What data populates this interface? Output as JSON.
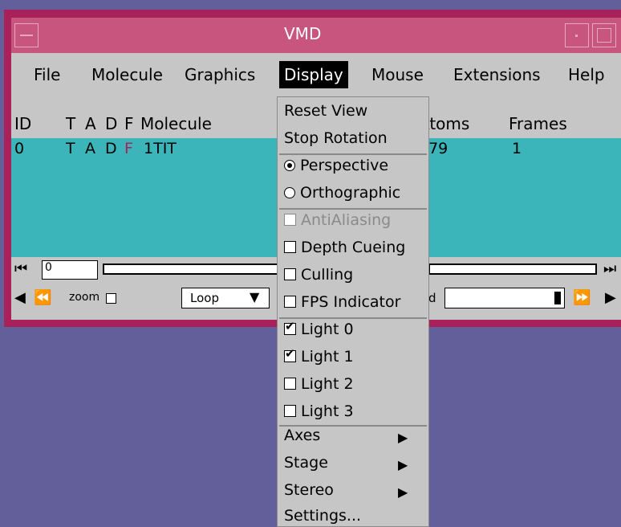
{
  "window": {
    "title": "VMD"
  },
  "menubar": {
    "items": [
      "File",
      "Molecule",
      "Graphics",
      "Display",
      "Mouse",
      "Extensions",
      "Help"
    ],
    "active": "Display"
  },
  "table": {
    "headers": [
      "ID",
      "T",
      "A",
      "D",
      "F",
      "Molecule",
      "Atoms",
      "Frames"
    ],
    "rows": [
      {
        "id": "0",
        "t": "T",
        "a": "A",
        "d": "D",
        "f": "F",
        "molecule": "1TIT",
        "atoms": "379",
        "frames": "1"
      }
    ]
  },
  "controls": {
    "frame_value": "0",
    "zoom_label": "zoom",
    "loop_value": "Loop",
    "speed_label": "d"
  },
  "display_menu": {
    "items": [
      {
        "label": "Reset View",
        "type": "command"
      },
      {
        "label": "Stop Rotation",
        "type": "command"
      },
      {
        "label": "Perspective",
        "type": "radio",
        "selected": true
      },
      {
        "label": "Orthographic",
        "type": "radio",
        "selected": false
      },
      {
        "label": "AntiAliasing",
        "type": "check",
        "checked": false,
        "disabled": true
      },
      {
        "label": "Depth Cueing",
        "type": "check",
        "checked": false
      },
      {
        "label": "Culling",
        "type": "check",
        "checked": false
      },
      {
        "label": "FPS Indicator",
        "type": "check",
        "checked": false
      },
      {
        "label": "Light 0",
        "type": "check",
        "checked": true
      },
      {
        "label": "Light 1",
        "type": "check",
        "checked": true
      },
      {
        "label": "Light 2",
        "type": "check",
        "checked": false
      },
      {
        "label": "Light 3",
        "type": "check",
        "checked": false
      },
      {
        "label": "Axes",
        "type": "submenu"
      },
      {
        "label": "Stage",
        "type": "submenu"
      },
      {
        "label": "Stereo",
        "type": "submenu"
      },
      {
        "label": "Settings...",
        "type": "command"
      }
    ]
  },
  "colors": {
    "desktop": "#625f9b",
    "window_frame": "#a8215a",
    "titlebar": "#c8557d",
    "list_bg": "#3bb5ba",
    "panel": "#c6c6c6",
    "disabled_text": "#8a8a8a"
  }
}
